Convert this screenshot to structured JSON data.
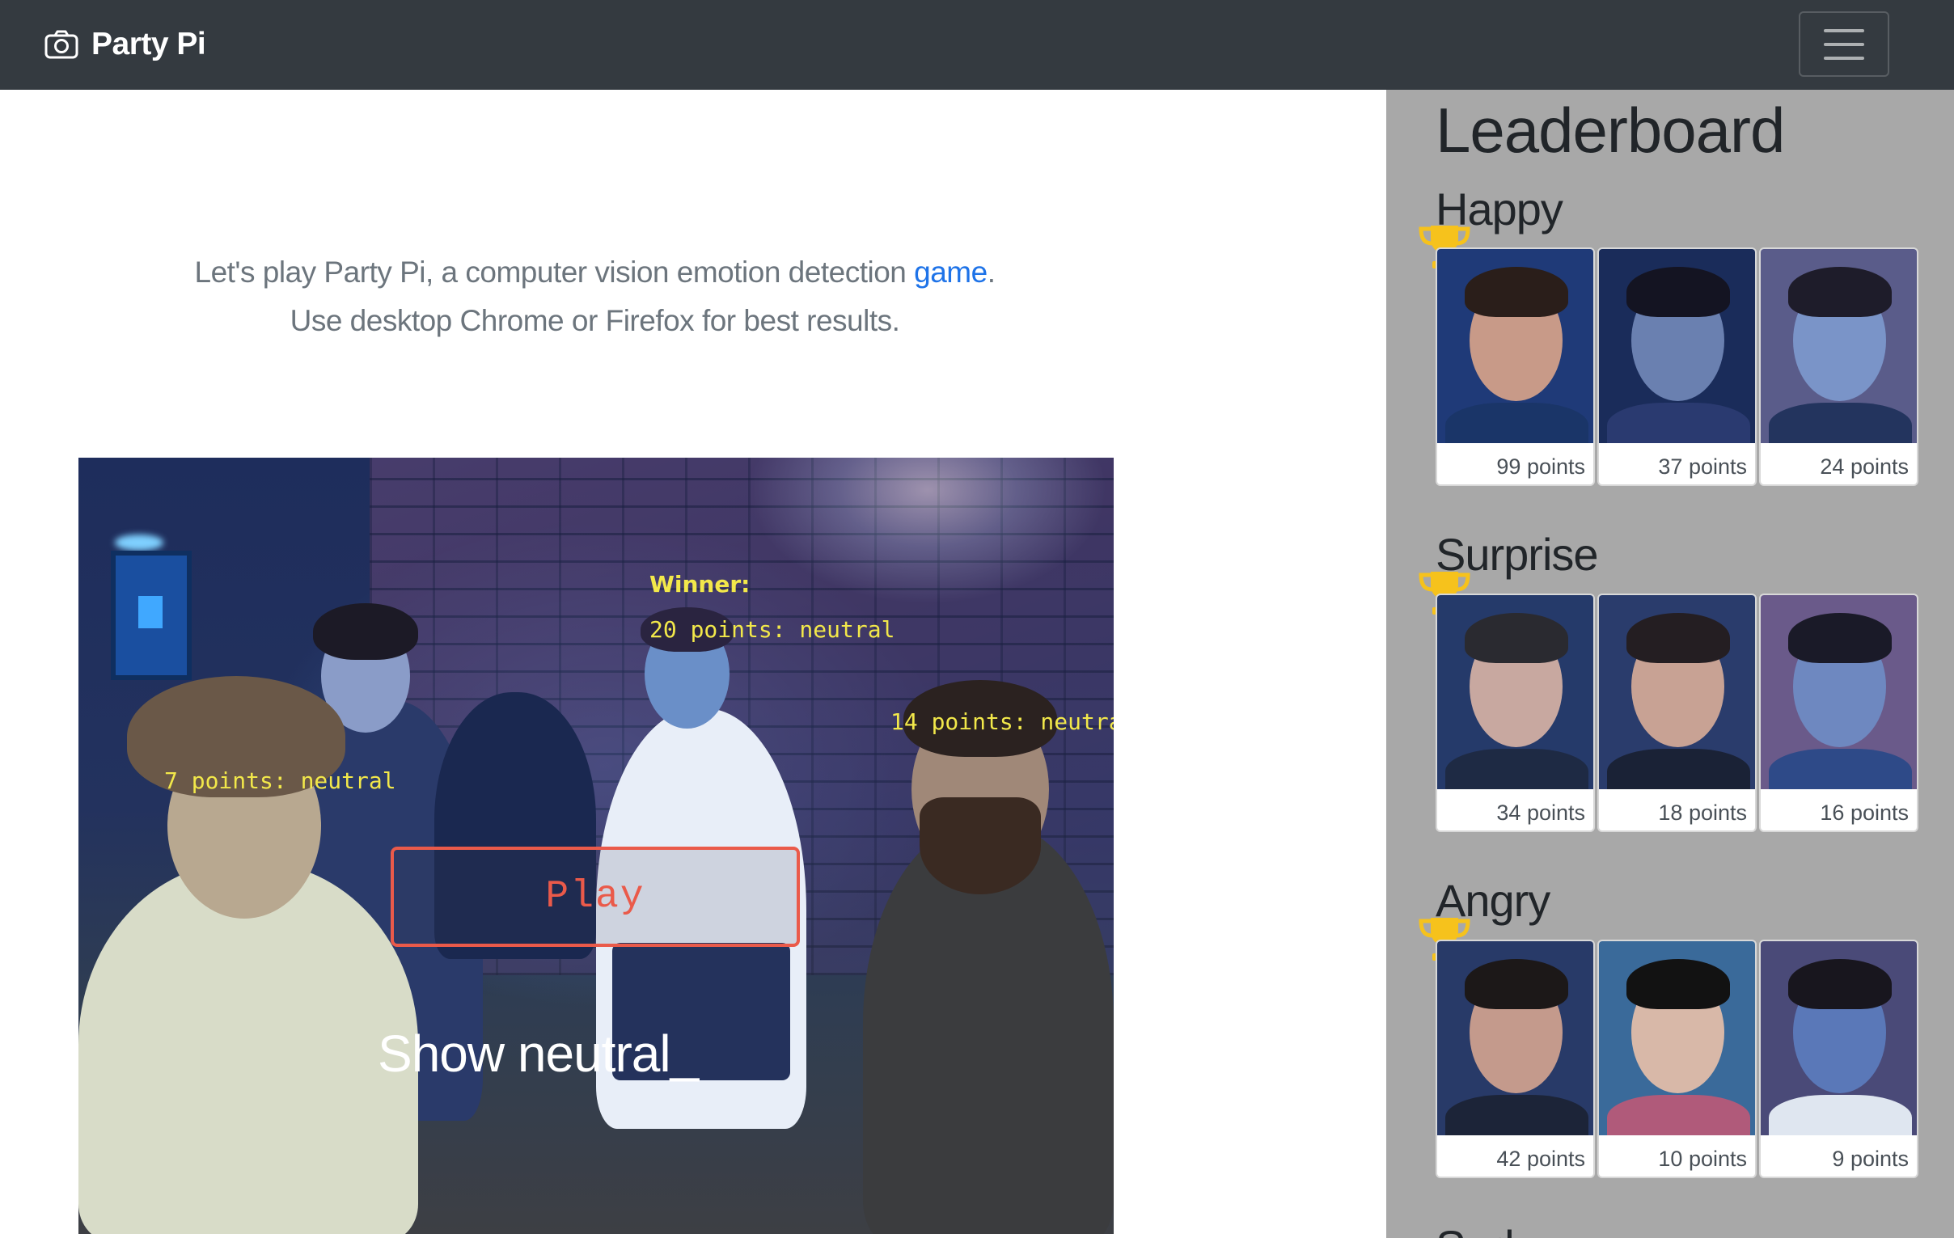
{
  "navbar": {
    "brand": "Party Pi",
    "brand_icon": "camera-icon",
    "toggler_icon": "hamburger-icon"
  },
  "intro": {
    "line1_prefix": "Let's play Party Pi, a computer vision emotion detection ",
    "link_text": "game",
    "line1_suffix": ".",
    "line2": "Use desktop Chrome or Firefox for best results."
  },
  "video": {
    "winner_label": "Winner:",
    "score_labels": [
      "20 points: neutral",
      "14 points: neutra",
      "7 points: neutral"
    ],
    "play_label": "Play",
    "prompt": "Show neutral_"
  },
  "leaderboard": {
    "title": "Leaderboard",
    "accent_trophy": "#f6c21c",
    "categories": [
      {
        "name": "Happy",
        "entries": [
          {
            "points": "99 points"
          },
          {
            "points": "37 points"
          },
          {
            "points": "24 points"
          }
        ]
      },
      {
        "name": "Surprise",
        "entries": [
          {
            "points": "34 points"
          },
          {
            "points": "18 points"
          },
          {
            "points": "16 points"
          }
        ]
      },
      {
        "name": "Angry",
        "entries": [
          {
            "points": "42 points"
          },
          {
            "points": "10 points"
          },
          {
            "points": "9 points"
          }
        ]
      },
      {
        "name": "Sad"
      }
    ]
  }
}
